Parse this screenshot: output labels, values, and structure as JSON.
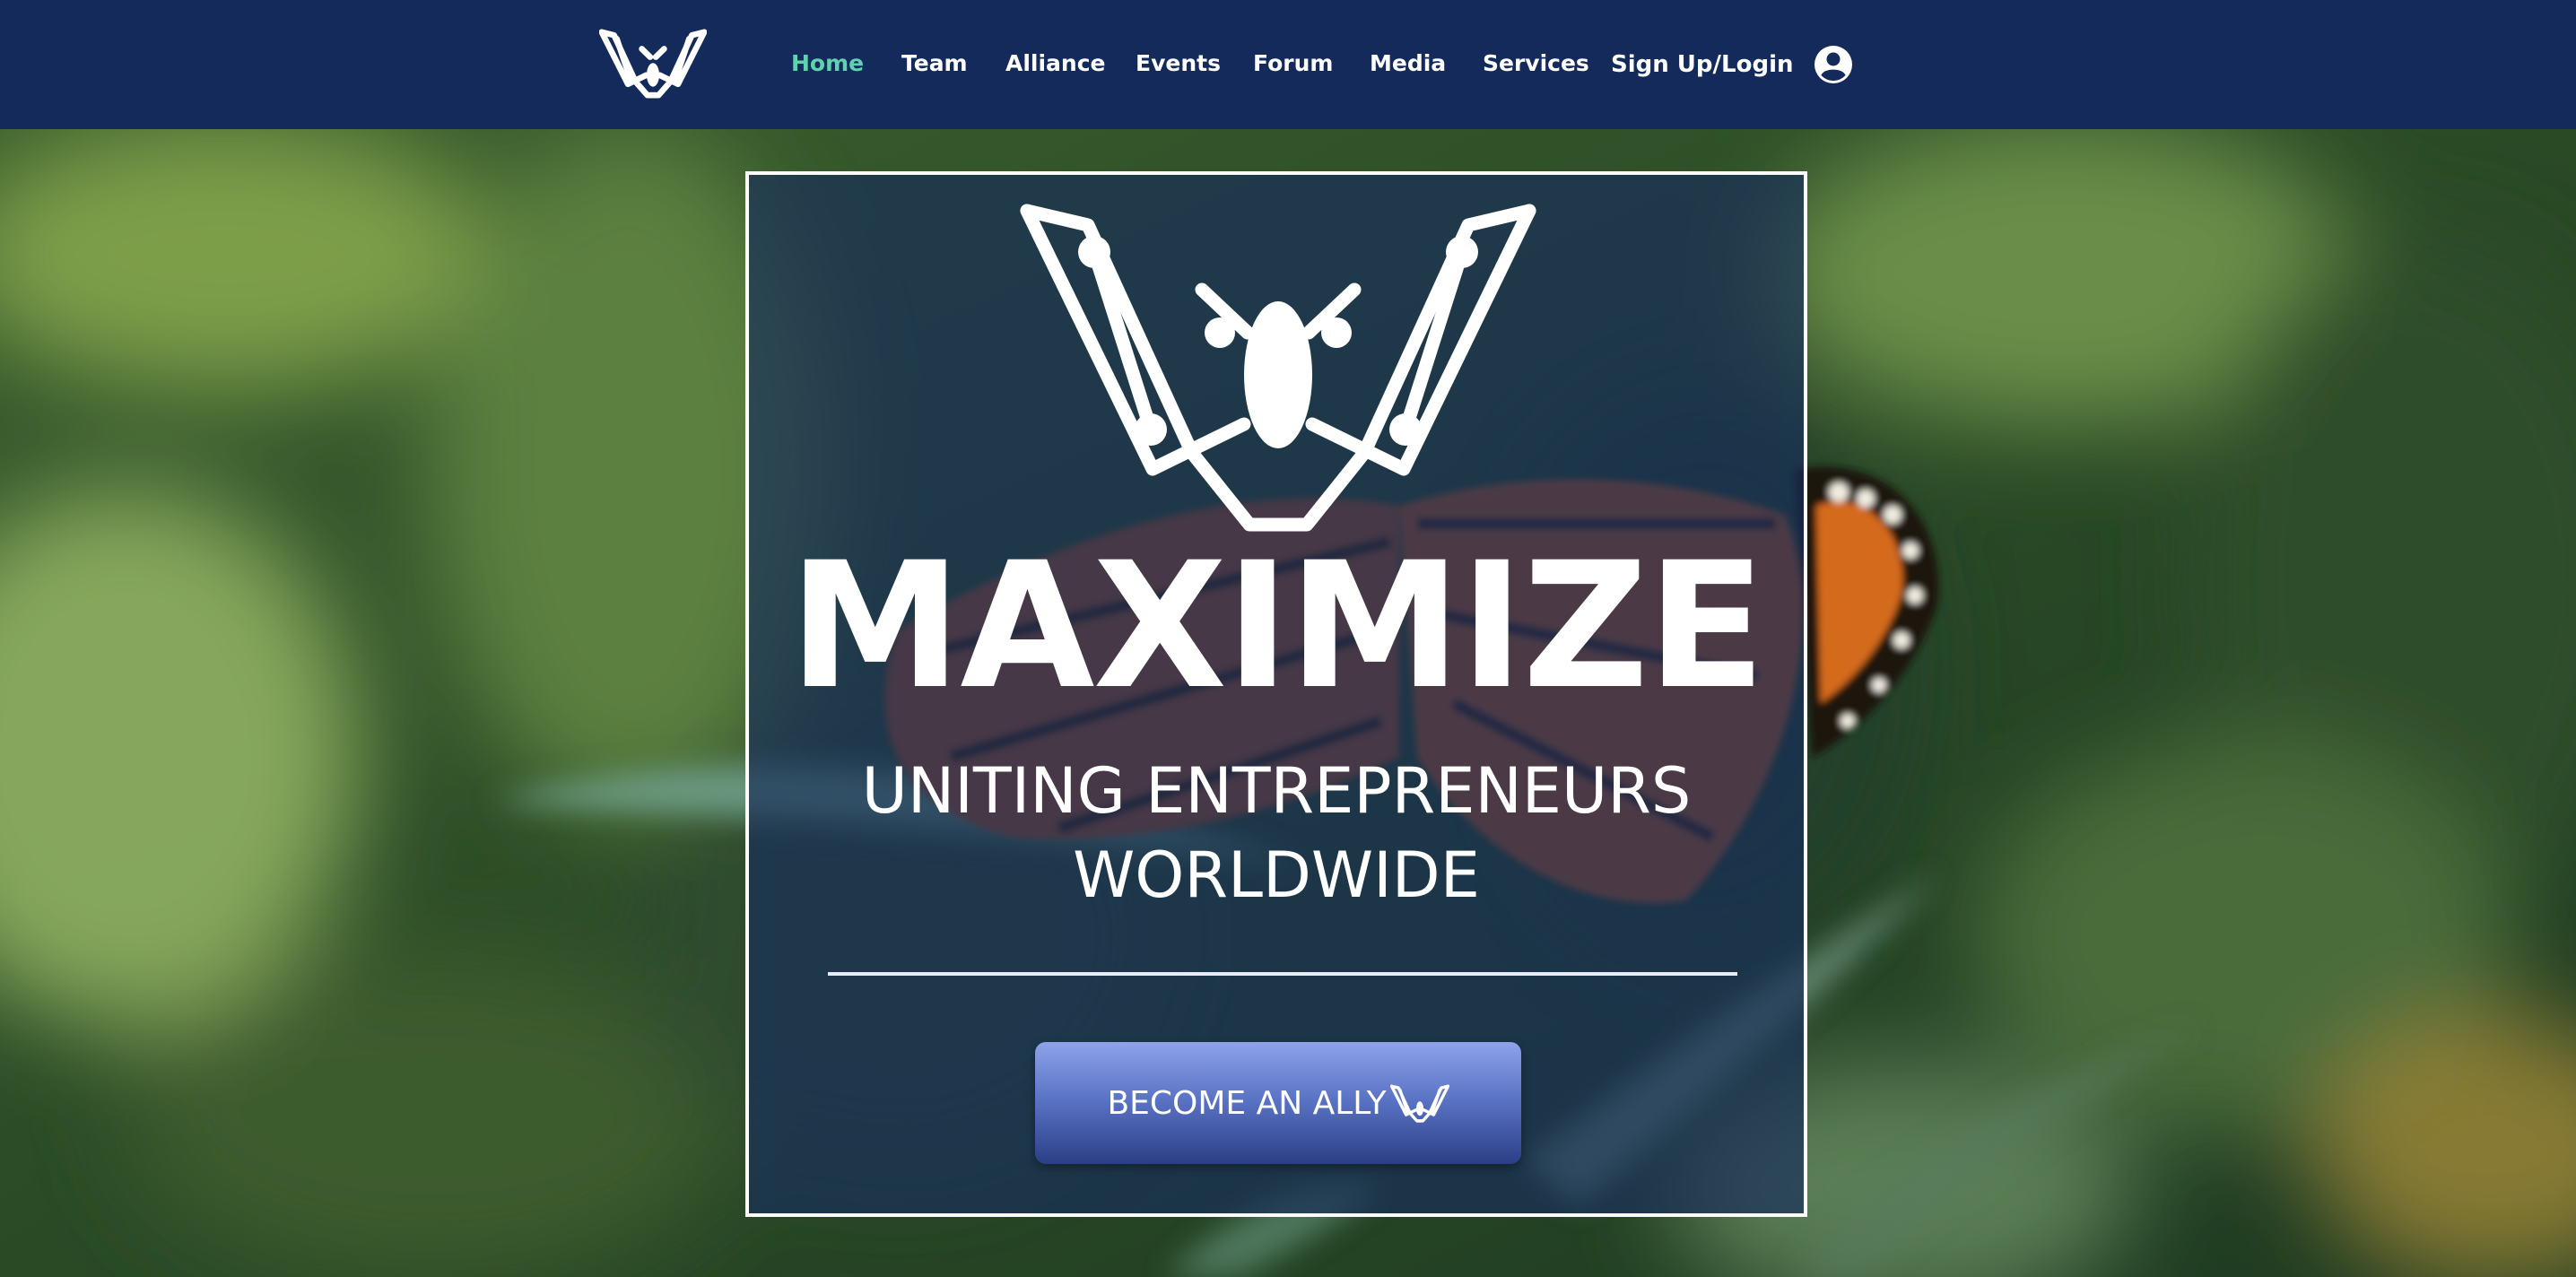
{
  "nav": {
    "items": [
      {
        "label": "Home",
        "active": true
      },
      {
        "label": "Team",
        "active": false
      },
      {
        "label": "Alliance",
        "active": false
      },
      {
        "label": "Events",
        "active": false
      },
      {
        "label": "Forum",
        "active": false
      },
      {
        "label": "Media",
        "active": false
      },
      {
        "label": "Services",
        "active": false
      }
    ],
    "login_label": "Sign Up/Login",
    "logo_icon": "butterfly-logo-icon",
    "avatar_icon": "user-avatar-icon"
  },
  "hero": {
    "title": "MAXIMIZE",
    "subtitle_line1": "UNITING ENTREPRENEURS",
    "subtitle_line2": "WORLDWIDE",
    "cta_label": "BECOME AN ALLY",
    "background_image": "monarch-butterfly-on-milkweed"
  },
  "colors": {
    "nav_bg": "#142a5a",
    "nav_active": "#5fd3b0",
    "nav_text": "#ffffff",
    "card_overlay": "#182d5a",
    "cta_top": "#8ea3ea",
    "cta_bottom": "#2b3f86"
  }
}
